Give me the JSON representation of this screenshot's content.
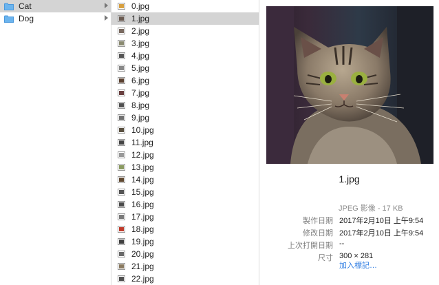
{
  "folders": [
    {
      "label": "Cat",
      "selected": true
    },
    {
      "label": "Dog",
      "selected": false
    }
  ],
  "files": [
    {
      "label": "0.jpg",
      "thumb": "#d8a040"
    },
    {
      "label": "1.jpg",
      "thumb": "#6a5a50",
      "selected": true
    },
    {
      "label": "2.jpg",
      "thumb": "#7a6a60"
    },
    {
      "label": "3.jpg",
      "thumb": "#8a8a70"
    },
    {
      "label": "4.jpg",
      "thumb": "#555555"
    },
    {
      "label": "5.jpg",
      "thumb": "#888888"
    },
    {
      "label": "6.jpg",
      "thumb": "#5a4030"
    },
    {
      "label": "7.jpg",
      "thumb": "#6a4040"
    },
    {
      "label": "8.jpg",
      "thumb": "#505050"
    },
    {
      "label": "9.jpg",
      "thumb": "#707070"
    },
    {
      "label": "10.jpg",
      "thumb": "#5a5040"
    },
    {
      "label": "11.jpg",
      "thumb": "#444444"
    },
    {
      "label": "12.jpg",
      "thumb": "#999999"
    },
    {
      "label": "13.jpg",
      "thumb": "#8a9a60"
    },
    {
      "label": "14.jpg",
      "thumb": "#604830"
    },
    {
      "label": "15.jpg",
      "thumb": "#555555"
    },
    {
      "label": "16.jpg",
      "thumb": "#4a4a4a"
    },
    {
      "label": "17.jpg",
      "thumb": "#7a7a7a"
    },
    {
      "label": "18.jpg",
      "thumb": "#c03a2a"
    },
    {
      "label": "19.jpg",
      "thumb": "#404040"
    },
    {
      "label": "20.jpg",
      "thumb": "#6a6a6a"
    },
    {
      "label": "21.jpg",
      "thumb": "#8a7a60"
    },
    {
      "label": "22.jpg",
      "thumb": "#505050"
    }
  ],
  "preview": {
    "filename": "1.jpg",
    "kind": "JPEG 影像 - 17 KB",
    "info": [
      {
        "key": "製作日期",
        "value": "2017年2月10日 上午9:54"
      },
      {
        "key": "修改日期",
        "value": "2017年2月10日 上午9:54"
      },
      {
        "key": "上次打開日期",
        "value": "--"
      },
      {
        "key": "尺寸",
        "value": "300 × 281"
      }
    ],
    "add_tags": "加入標記…"
  }
}
